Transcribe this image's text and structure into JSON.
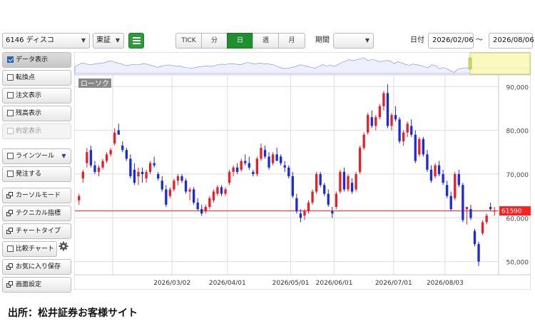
{
  "toolbar": {
    "symbol_select": "6146 ディスコ",
    "market_select": "東証",
    "period_tabs": [
      "TICK",
      "分",
      "日",
      "週",
      "月"
    ],
    "active_period": "日",
    "range_label": "期間",
    "range_select": "",
    "date_label": "日付",
    "date_from": "2026/02/06",
    "date_sep": "～",
    "date_to": "2026/08/06"
  },
  "sidebar": {
    "items": [
      {
        "label": "データ表示",
        "kind": "check",
        "checked": true,
        "active": true
      },
      {
        "label": "転換点",
        "kind": "check",
        "checked": false
      },
      {
        "label": "注文表示",
        "kind": "check",
        "checked": false
      },
      {
        "label": "残高表示",
        "kind": "check",
        "checked": false
      },
      {
        "label": "約定表示",
        "kind": "check",
        "checked": false,
        "disabled": true
      },
      {
        "label": "ラインツール",
        "kind": "check-drop",
        "checked": false
      },
      {
        "label": "発注する",
        "kind": "check",
        "checked": false
      },
      {
        "label": "カーソルモード",
        "kind": "window"
      },
      {
        "label": "テクニカル指標",
        "kind": "window"
      },
      {
        "label": "チャートタイプ",
        "kind": "window"
      },
      {
        "label": "比較チャート",
        "kind": "check-gear",
        "checked": false
      },
      {
        "label": "お気に入り保存",
        "kind": "window"
      },
      {
        "label": "画面設定",
        "kind": "window"
      }
    ]
  },
  "chart": {
    "label": "ローソク",
    "current_price_label": "61590",
    "colors": {
      "up": "#e2222b",
      "down": "#1c2bd4",
      "price_line": "#ff3b3b",
      "badge": "#ff2222",
      "grid": "#dddddd",
      "navigator_fill": "#eef0ff",
      "navigator_line": "#7d86d8",
      "navigator_window": "#fafab5"
    }
  },
  "caption": "出所：松井証券お客様サイト",
  "chart_data": {
    "type": "candlestick",
    "y_tick_labels": [
      "90,000",
      "80,000",
      "70,000",
      "60,000",
      "50,000"
    ],
    "y_ticks": [
      90000,
      80000,
      70000,
      60000,
      50000
    ],
    "x_tick_labels": [
      "2026/03/02",
      "2026/04/01",
      "2026/05/01",
      "2026/06/01",
      "2026/07/01",
      "2026/08/03"
    ],
    "ylim": [
      47000,
      92000
    ],
    "current_price": 61590,
    "candles": [
      [
        64000,
        65500,
        63000,
        65000
      ],
      [
        69000,
        71000,
        68000,
        70500
      ],
      [
        72500,
        76000,
        71500,
        75000
      ],
      [
        75500,
        76500,
        71500,
        72000
      ],
      [
        72000,
        73000,
        70000,
        70500
      ],
      [
        70500,
        72000,
        69500,
        71500
      ],
      [
        71500,
        73500,
        71000,
        73000
      ],
      [
        73000,
        75000,
        72500,
        74500
      ],
      [
        74500,
        76000,
        74000,
        75500
      ],
      [
        77000,
        80500,
        76500,
        79500
      ],
      [
        80000,
        81500,
        79000,
        79000
      ],
      [
        76500,
        77500,
        75000,
        75500
      ],
      [
        75500,
        76000,
        73000,
        73500
      ],
      [
        73500,
        74500,
        69000,
        69500
      ],
      [
        71000,
        72500,
        67500,
        68000
      ],
      [
        69500,
        71500,
        67500,
        70500
      ],
      [
        70500,
        71500,
        68000,
        70000
      ],
      [
        69000,
        71000,
        68000,
        70500
      ],
      [
        70500,
        73000,
        70000,
        72500
      ],
      [
        72500,
        74000,
        71500,
        72000
      ],
      [
        70000,
        70500,
        68500,
        69000
      ],
      [
        68500,
        69500,
        66000,
        66500
      ],
      [
        66500,
        67500,
        62500,
        63000
      ],
      [
        65000,
        67000,
        64500,
        66500
      ],
      [
        66500,
        69000,
        66000,
        68500
      ],
      [
        68500,
        70000,
        67500,
        69500
      ],
      [
        69500,
        70000,
        68000,
        68500
      ],
      [
        68500,
        69000,
        65500,
        66000
      ],
      [
        66000,
        67000,
        64000,
        66500
      ],
      [
        66500,
        67000,
        63000,
        63500
      ],
      [
        63500,
        64500,
        61500,
        62000
      ],
      [
        62000,
        63000,
        60500,
        61000
      ],
      [
        61500,
        63000,
        61000,
        62500
      ],
      [
        62500,
        65000,
        62000,
        64500
      ],
      [
        64000,
        66500,
        63500,
        66000
      ],
      [
        65500,
        67500,
        65000,
        67000
      ],
      [
        67000,
        67500,
        65000,
        65500
      ],
      [
        65500,
        67000,
        65000,
        66500
      ],
      [
        68000,
        71000,
        67500,
        70500
      ],
      [
        70500,
        72000,
        69500,
        71500
      ],
      [
        71500,
        72500,
        70000,
        70500
      ],
      [
        71000,
        73500,
        70500,
        73000
      ],
      [
        73000,
        74500,
        72000,
        72500
      ],
      [
        72500,
        74000,
        71000,
        71500
      ],
      [
        70500,
        71000,
        69500,
        70000
      ],
      [
        70000,
        74000,
        69500,
        73500
      ],
      [
        73500,
        77000,
        73000,
        76000
      ],
      [
        75500,
        76500,
        73500,
        74000
      ],
      [
        74000,
        75000,
        71000,
        71500
      ],
      [
        72500,
        75000,
        72000,
        74500
      ],
      [
        74500,
        76000,
        73500,
        73000
      ],
      [
        74000,
        74500,
        72000,
        72500
      ],
      [
        72000,
        73000,
        70500,
        71500
      ],
      [
        71500,
        72000,
        69000,
        69500
      ],
      [
        69500,
        70500,
        64500,
        65000
      ],
      [
        64500,
        65500,
        61000,
        61500
      ],
      [
        61000,
        62000,
        59000,
        60000
      ],
      [
        60500,
        62000,
        59500,
        61500
      ],
      [
        61500,
        64000,
        61000,
        63500
      ],
      [
        63500,
        66500,
        63000,
        66000
      ],
      [
        66000,
        70500,
        65500,
        70000
      ],
      [
        70000,
        70500,
        67000,
        67500
      ],
      [
        67500,
        68000,
        65000,
        65500
      ],
      [
        65500,
        66500,
        62500,
        63000
      ],
      [
        61500,
        62500,
        60000,
        61000
      ],
      [
        62500,
        66000,
        62000,
        65500
      ],
      [
        66000,
        71000,
        65500,
        70500
      ],
      [
        70500,
        71500,
        66000,
        66500
      ],
      [
        66500,
        70000,
        66000,
        69500
      ],
      [
        68000,
        69000,
        65500,
        66000
      ],
      [
        66500,
        70500,
        66000,
        70000
      ],
      [
        70500,
        76500,
        70000,
        76000
      ],
      [
        76000,
        79500,
        75500,
        79000
      ],
      [
        79500,
        84000,
        79000,
        83500
      ],
      [
        83000,
        84500,
        80500,
        81000
      ],
      [
        81000,
        83500,
        80000,
        83000
      ],
      [
        83000,
        86000,
        82500,
        85500
      ],
      [
        85500,
        89000,
        84500,
        88500
      ],
      [
        88500,
        90500,
        80500,
        81000
      ],
      [
        81000,
        84000,
        80000,
        83500
      ],
      [
        83500,
        85500,
        82000,
        82500
      ],
      [
        82500,
        83000,
        77000,
        77500
      ],
      [
        77500,
        80000,
        76500,
        79500
      ],
      [
        79500,
        82000,
        78500,
        81500
      ],
      [
        81000,
        82500,
        78500,
        79000
      ],
      [
        79000,
        80000,
        72500,
        73000
      ],
      [
        74500,
        78500,
        74000,
        78000
      ],
      [
        78000,
        78500,
        74000,
        74500
      ],
      [
        74500,
        75500,
        70500,
        71000
      ],
      [
        71000,
        72000,
        68000,
        68500
      ],
      [
        69500,
        72500,
        69000,
        72000
      ],
      [
        72000,
        73000,
        69500,
        70000
      ],
      [
        70000,
        71000,
        67500,
        68000
      ],
      [
        67500,
        68500,
        64500,
        65000
      ],
      [
        65000,
        66000,
        61500,
        62000
      ],
      [
        64500,
        70500,
        64000,
        70000
      ],
      [
        70000,
        71000,
        67000,
        67500
      ],
      [
        67500,
        68000,
        59000,
        59500
      ],
      [
        62000,
        62500,
        58500,
        62500
      ],
      [
        62000,
        63000,
        59500,
        60000
      ],
      [
        57000,
        57500,
        53500,
        54000
      ],
      [
        54000,
        54500,
        49000,
        50000
      ],
      [
        56500,
        59500,
        56000,
        59000
      ],
      [
        59000,
        61000,
        58500,
        60500
      ],
      [
        62500,
        63500,
        61500,
        62000
      ],
      [
        61500,
        62500,
        60500,
        61590
      ]
    ],
    "month_start_indices": [
      9,
      24,
      38,
      54,
      65,
      80,
      93
    ],
    "navigator_window": [
      "2026/08/03",
      "2026/08/06"
    ]
  }
}
